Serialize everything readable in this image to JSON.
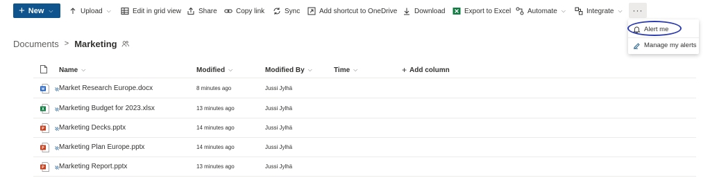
{
  "commandbar": {
    "new_label": "New",
    "upload_label": "Upload",
    "edit_grid_label": "Edit in grid view",
    "share_label": "Share",
    "copy_link_label": "Copy link",
    "sync_label": "Sync",
    "add_shortcut_label": "Add shortcut to OneDrive",
    "download_label": "Download",
    "export_excel_label": "Export to Excel",
    "automate_label": "Automate",
    "integrate_label": "Integrate",
    "more_label": "···"
  },
  "dropdown": {
    "items": [
      {
        "label": "Alert me",
        "icon": "bell-icon"
      },
      {
        "label": "Manage my alerts",
        "icon": "edit-alerts-icon"
      }
    ]
  },
  "breadcrumb": {
    "root": "Documents",
    "separator": ">",
    "current": "Marketing"
  },
  "list": {
    "columns": {
      "name": "Name",
      "modified": "Modified",
      "modified_by": "Modified By",
      "time": "Time",
      "add_column": "Add column"
    },
    "rows": [
      {
        "type": "word",
        "name": "Market Research Europe.docx",
        "modified": "8 minutes ago",
        "modified_by": "Jussi Jylhä"
      },
      {
        "type": "excel",
        "name": "Marketing Budget for 2023.xlsx",
        "modified": "13 minutes ago",
        "modified_by": "Jussi Jylhä"
      },
      {
        "type": "powerpoint",
        "name": "Marketing Decks.pptx",
        "modified": "14 minutes ago",
        "modified_by": "Jussi Jylhä"
      },
      {
        "type": "powerpoint",
        "name": "Marketing Plan Europe.pptx",
        "modified": "14 minutes ago",
        "modified_by": "Jussi Jylhä"
      },
      {
        "type": "powerpoint",
        "name": "Marketing Report.pptx",
        "modified": "13 minutes ago",
        "modified_by": "Jussi Jylhä"
      }
    ]
  },
  "colors": {
    "primary": "#0f548c",
    "word": "#185abd",
    "excel": "#107c41",
    "powerpoint": "#c43e1c",
    "highlight_circle": "#2b3bb0"
  }
}
